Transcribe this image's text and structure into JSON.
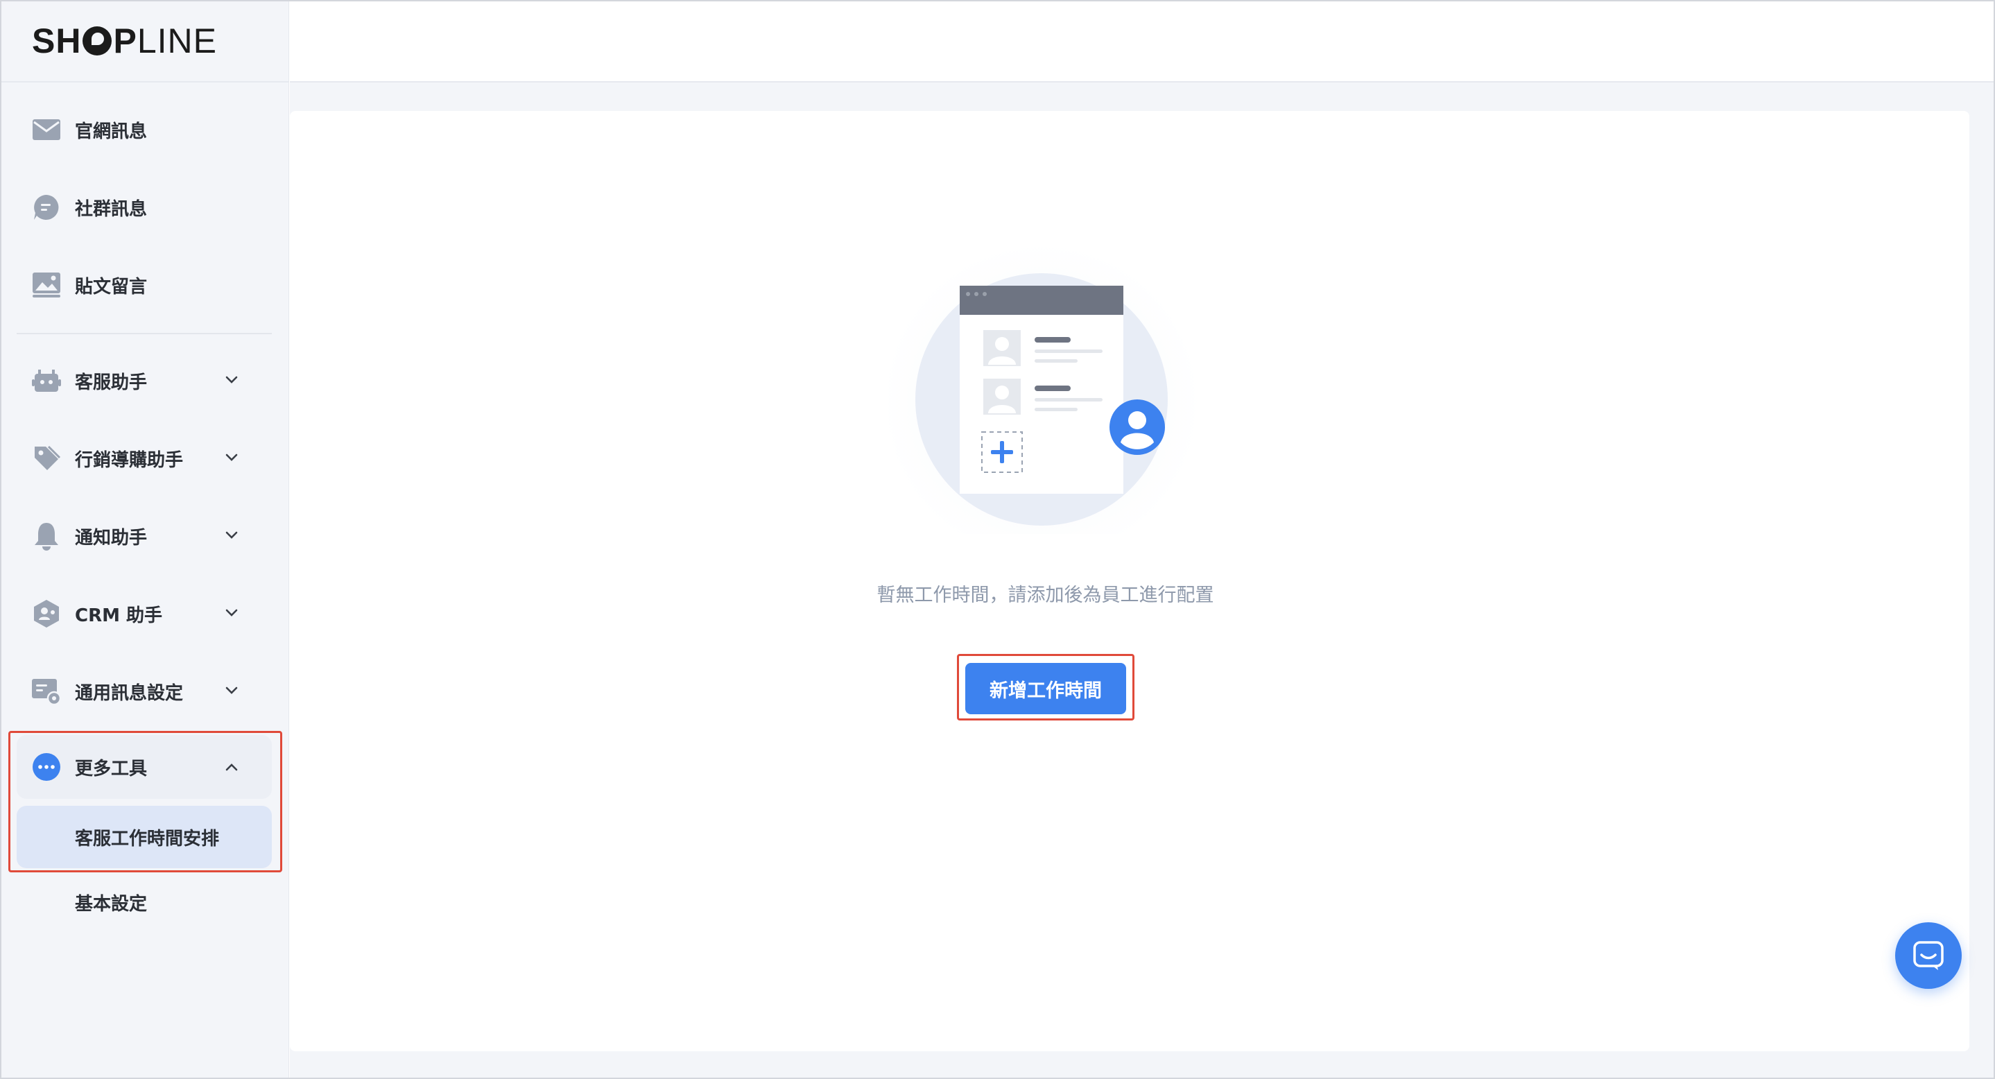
{
  "brand": {
    "logo_bold": "SH",
    "logo_after": "P",
    "logo_light": "LINE"
  },
  "sidebar": {
    "items": [
      {
        "label": "官網訊息",
        "icon": "mail-icon"
      },
      {
        "label": "社群訊息",
        "icon": "chat-bubble-icon"
      },
      {
        "label": "貼文留言",
        "icon": "image-post-icon"
      },
      {
        "label": "客服助手",
        "icon": "robot-icon",
        "expandable": true
      },
      {
        "label": "行銷導購助手",
        "icon": "tag-icon",
        "expandable": true
      },
      {
        "label": "通知助手",
        "icon": "bell-icon",
        "expandable": true
      },
      {
        "label": "CRM 助手",
        "icon": "crm-hexagon-icon",
        "expandable": true
      },
      {
        "label": "通用訊息設定",
        "icon": "message-settings-icon",
        "expandable": true
      }
    ],
    "more_tools": {
      "label": "更多工具",
      "icon": "more-dots-icon",
      "expanded": true,
      "children": [
        {
          "label": "客服工作時間安排",
          "active": true
        },
        {
          "label": "基本設定",
          "active": false
        }
      ]
    }
  },
  "main": {
    "empty_state": {
      "message": "暫無工作時間，請添加後為員工進行配置",
      "illustration": "staff-schedule-empty-illustration"
    },
    "add_button": "新增工作時間"
  },
  "colors": {
    "accent": "#3d82ef",
    "highlight": "#e04a3a",
    "sidebar_bg": "#f3f5f9",
    "active_bg": "#dde6f7"
  }
}
